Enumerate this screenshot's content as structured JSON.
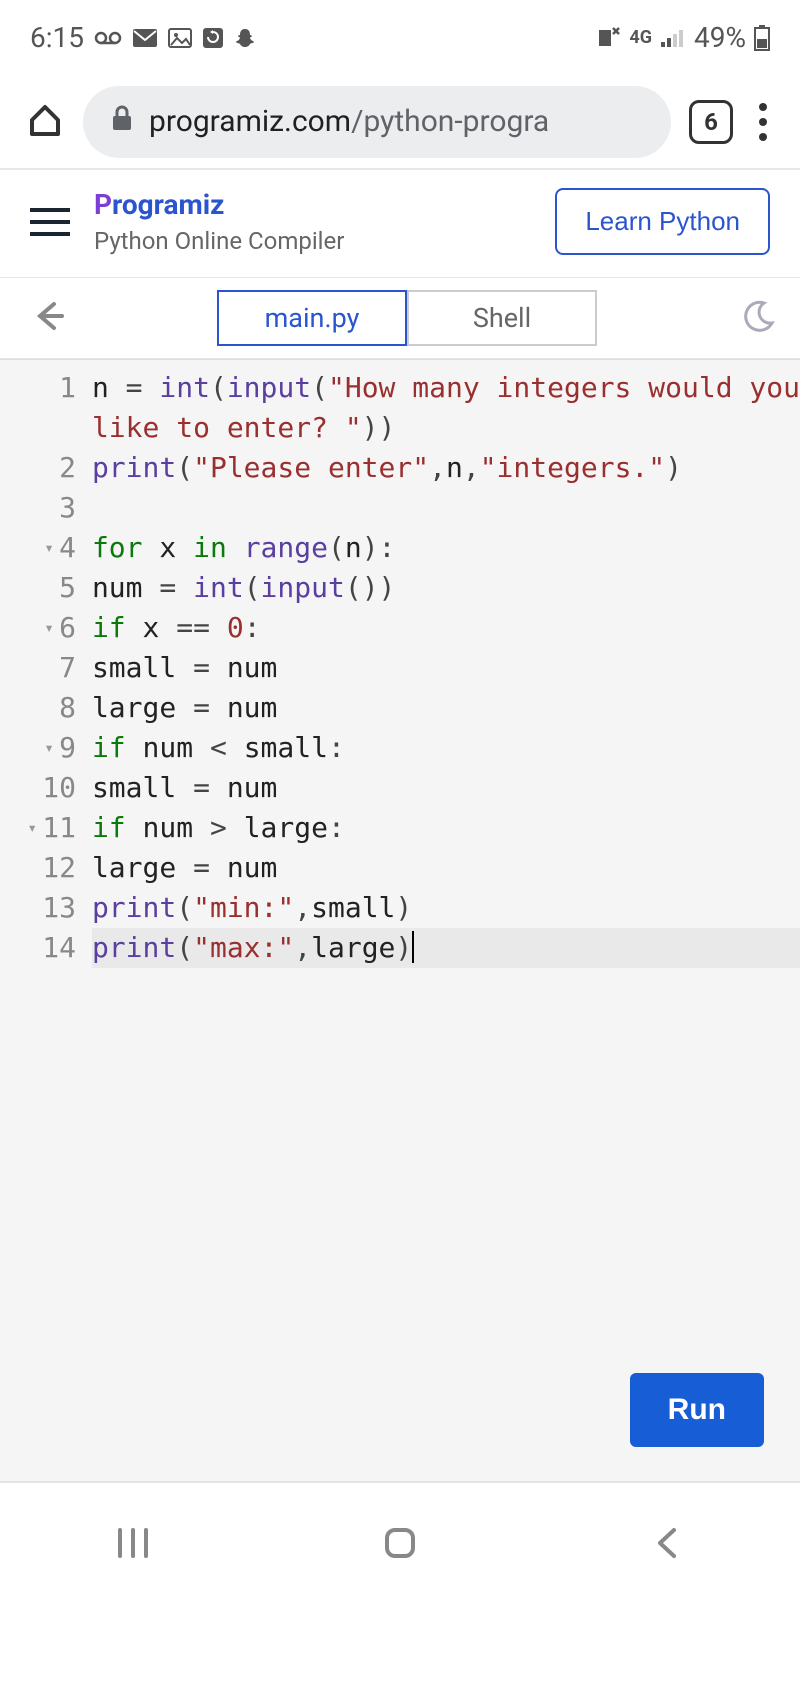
{
  "status_bar": {
    "time": "6:15",
    "battery_pct": "49%"
  },
  "browser": {
    "url_domain": "programiz.com",
    "url_path": "/python-progra",
    "tab_count": "6"
  },
  "header": {
    "brand": "rogramiz",
    "brand_sub": "Python Online Compiler",
    "learn_btn": "Learn Python"
  },
  "tabs": {
    "main": "main.py",
    "shell": "Shell"
  },
  "editor": {
    "run_label": "Run",
    "lines": [
      {
        "num": "1",
        "fold": ""
      },
      {
        "num": "",
        "fold": ""
      },
      {
        "num": "2",
        "fold": ""
      },
      {
        "num": "3",
        "fold": ""
      },
      {
        "num": "4",
        "fold": "▾"
      },
      {
        "num": "5",
        "fold": ""
      },
      {
        "num": "6",
        "fold": "▾"
      },
      {
        "num": "7",
        "fold": ""
      },
      {
        "num": "8",
        "fold": ""
      },
      {
        "num": "9",
        "fold": "▾"
      },
      {
        "num": "10",
        "fold": ""
      },
      {
        "num": "11",
        "fold": "▾"
      },
      {
        "num": "12",
        "fold": ""
      },
      {
        "num": "13",
        "fold": ""
      },
      {
        "num": "14",
        "fold": ""
      }
    ],
    "code": {
      "l1_id_n": "n ",
      "l1_op_eq": "= ",
      "l1_fn_int": "int",
      "l1_p1": "(",
      "l1_fn_input": "input",
      "l1_p2": "(",
      "l1_str_a": "\"How many integers would you",
      "l1b_str": "like to enter? \"",
      "l1b_p": "))",
      "l2_fn_print": "print",
      "l2_p1": "(",
      "l2_str": "\"Please enter\"",
      "l2_c1": ",",
      "l2_id_n": "n",
      "l2_c2": ",",
      "l2_str2": "\"integers.\"",
      "l2_p2": ")",
      "l4_for": "for",
      "l4_x": " x ",
      "l4_in": "in",
      "l4_sp": " ",
      "l4_range": "range",
      "l4_p1": "(",
      "l4_n": "n",
      "l4_p2": "):",
      "l5_num": "    num ",
      "l5_eq": "= ",
      "l5_int": "int",
      "l5_p1": "(",
      "l5_input": "input",
      "l5_p2": "())",
      "l6_if": "    if",
      "l6_x": " x ",
      "l6_eq": "== ",
      "l6_zero": "0",
      "l6_colon": ":",
      "l7_small": "        small ",
      "l7_eq": "= ",
      "l7_num": "num",
      "l8_large": "        large ",
      "l8_eq": "= ",
      "l8_num": "num",
      "l9_if": "    if",
      "l9_num": " num ",
      "l9_lt": "< ",
      "l9_small": "small",
      "l9_colon": ":",
      "l10_small": "        small ",
      "l10_eq": "= ",
      "l10_num": "num",
      "l11_if": "    if",
      "l11_num": " num ",
      "l11_gt": "> ",
      "l11_large": "large",
      "l11_colon": ":",
      "l12_large": "        large ",
      "l12_eq": "= ",
      "l12_num": "num",
      "l13_print": "print",
      "l13_p1": "(",
      "l13_str": "\"min:\"",
      "l13_c": ",",
      "l13_small": "small",
      "l13_p2": ")",
      "l14_print": "print",
      "l14_p1": "(",
      "l14_str": "\"max:\"",
      "l14_c": ",",
      "l14_large": "large",
      "l14_p2": ")"
    }
  }
}
